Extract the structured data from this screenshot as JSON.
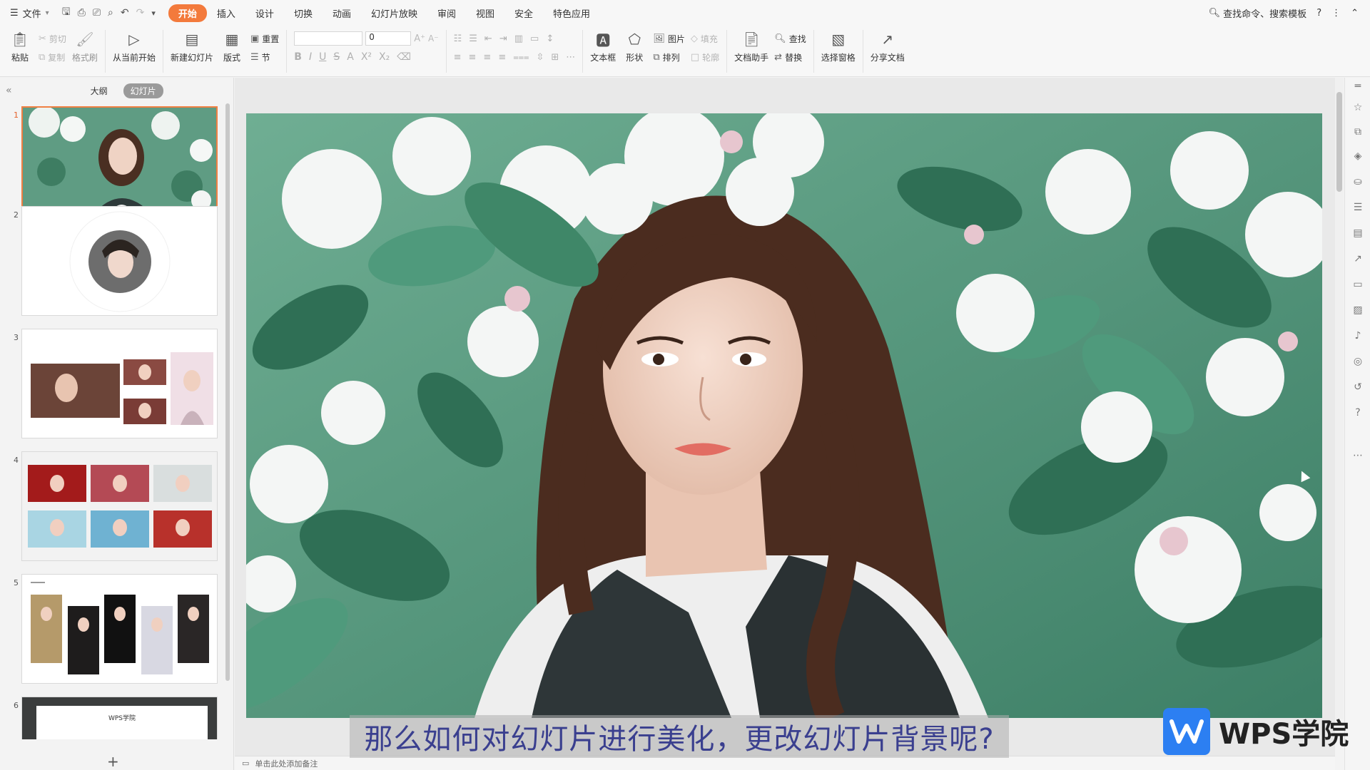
{
  "menu": {
    "file_label": "文件",
    "tabs": [
      "开始",
      "插入",
      "设计",
      "切换",
      "动画",
      "幻灯片放映",
      "审阅",
      "视图",
      "安全",
      "特色应用"
    ],
    "active_tab": "开始",
    "search": "查找命令、搜索模板"
  },
  "ribbon": {
    "paste": "粘贴",
    "cut": "剪切",
    "copy": "复制",
    "format_painter": "格式刷",
    "play_from_current": "从当前开始",
    "new_slide": "新建幻灯片",
    "layout": "版式",
    "reset": "重置",
    "section": "节",
    "font_name": "",
    "font_size": "0",
    "textbox": "文本框",
    "shape": "形状",
    "picture": "图片",
    "fill": "填充",
    "arrange": "排列",
    "outline": "轮廓",
    "doc_helper": "文档助手",
    "find": "查找",
    "replace": "替换",
    "select_pane": "选择窗格",
    "share_doc": "分享文档"
  },
  "left_pane": {
    "tab_outline": "大纲",
    "tab_slides": "幻灯片",
    "slide_numbers": [
      "1",
      "2",
      "3",
      "4",
      "5",
      "6"
    ],
    "slide6_title": "WPS学院"
  },
  "notes_placeholder": "单击此处添加备注",
  "subtitle": "那么如何对幻灯片进行美化，更改幻灯片背景呢?",
  "brand": "WPS学院",
  "colors": {
    "accent": "#f37a3c",
    "brand_blue": "#2c7ff2",
    "subtitle_text": "#3a3f8f"
  }
}
